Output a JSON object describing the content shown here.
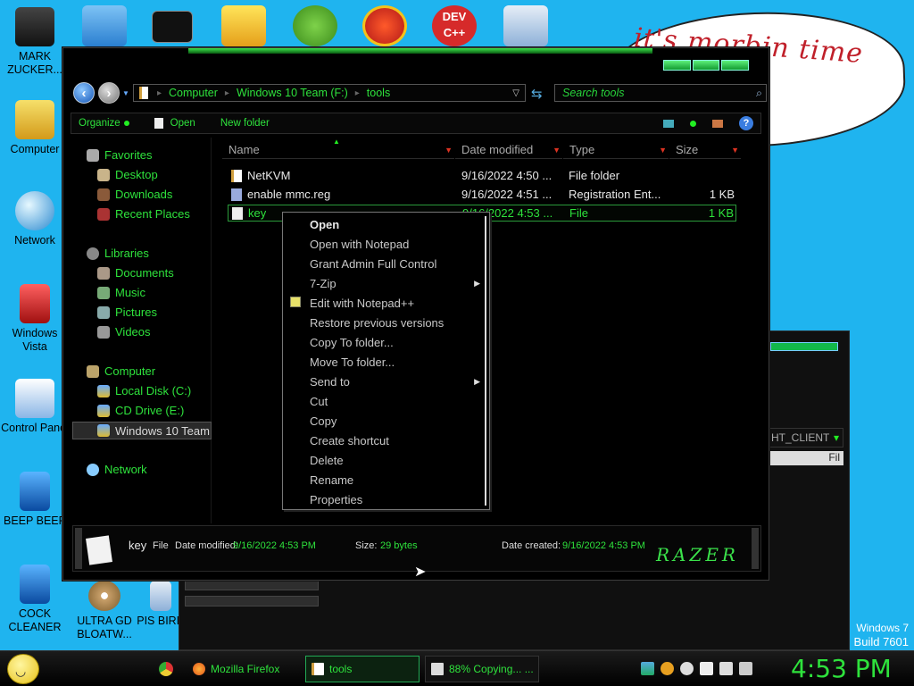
{
  "desktop": {
    "icons": [
      {
        "label": "MARK ZUCKER..."
      },
      {
        "label": "Computer"
      },
      {
        "label": "Network"
      },
      {
        "label": "Windows Vista"
      },
      {
        "label": "Control Panel"
      },
      {
        "label": "BEEP BEEP"
      },
      {
        "label": "COCK CLEANER"
      },
      {
        "label": "ULTRA GD BLOATW..."
      },
      {
        "label": "PIS BIRD"
      }
    ],
    "top_icons": [
      {
        "name": "folder-icon"
      },
      {
        "name": "cmd-icon"
      },
      {
        "name": "cleaner-icon"
      },
      {
        "name": "angry-birds-icon"
      },
      {
        "name": "powerpoint-p-icon"
      },
      {
        "name": "dev-cpp-icon"
      },
      {
        "name": "installer-icon"
      }
    ],
    "dev_label": "DEV\nC++",
    "speech_bubble": "it's morbin  time",
    "windows_version": "Windows 7",
    "build": "Build 7601",
    "bg_window": {
      "combo_text": "HT_CLIENT",
      "fil_text": "Fil"
    }
  },
  "explorer": {
    "breadcrumb": [
      "Computer",
      "Windows 10 Team (F:)",
      "tools"
    ],
    "search_placeholder": "Search tools",
    "commands": {
      "organize": "Organize",
      "open": "Open",
      "new_folder": "New folder"
    },
    "nav": {
      "favorites": "Favorites",
      "desktop": "Desktop",
      "downloads": "Downloads",
      "recent": "Recent Places",
      "libraries": "Libraries",
      "documents": "Documents",
      "music": "Music",
      "pictures": "Pictures",
      "videos": "Videos",
      "computer": "Computer",
      "local_disk": "Local Disk (C:)",
      "cd_drive": "CD Drive (E:)",
      "win10": "Windows 10 Team",
      "network": "Network"
    },
    "columns": {
      "name": "Name",
      "date": "Date modified",
      "type": "Type",
      "size": "Size"
    },
    "files": [
      {
        "name": "NetKVM",
        "date": "9/16/2022 4:50 ...",
        "type": "File folder",
        "size": ""
      },
      {
        "name": "enable mmc.reg",
        "date": "9/16/2022 4:51 ...",
        "type": "Registration Ent...",
        "size": "1 KB"
      },
      {
        "name": "key",
        "date": "9/16/2022 4:53 ...",
        "type": "File",
        "size": "1 KB"
      }
    ],
    "details": {
      "name": "key",
      "kind": "File",
      "date_modified_label": "Date modified:",
      "date_modified": "9/16/2022 4:53 PM",
      "size_label": "Size:",
      "size": "29 bytes",
      "date_created_label": "Date created:",
      "date_created": "9/16/2022 4:53 PM",
      "brand": "RAZER"
    }
  },
  "context_menu": {
    "items": [
      "Open",
      "Open with Notepad",
      "Grant Admin Full Control",
      "7-Zip",
      "Edit with Notepad++",
      "Restore previous versions",
      "Copy To folder...",
      "Move To folder...",
      "Send to",
      "Cut",
      "Copy",
      "Create shortcut",
      "Delete",
      "Rename",
      "Properties"
    ]
  },
  "taskbar": {
    "tasks": [
      {
        "label": "Mozilla Firefox"
      },
      {
        "label": "tools"
      },
      {
        "label": "88% Copying... ..."
      }
    ],
    "clock": "4:53 PM"
  },
  "colors": {
    "accent": "#2ee23c",
    "desktop": "#1fb4ef",
    "window": "#000000"
  }
}
